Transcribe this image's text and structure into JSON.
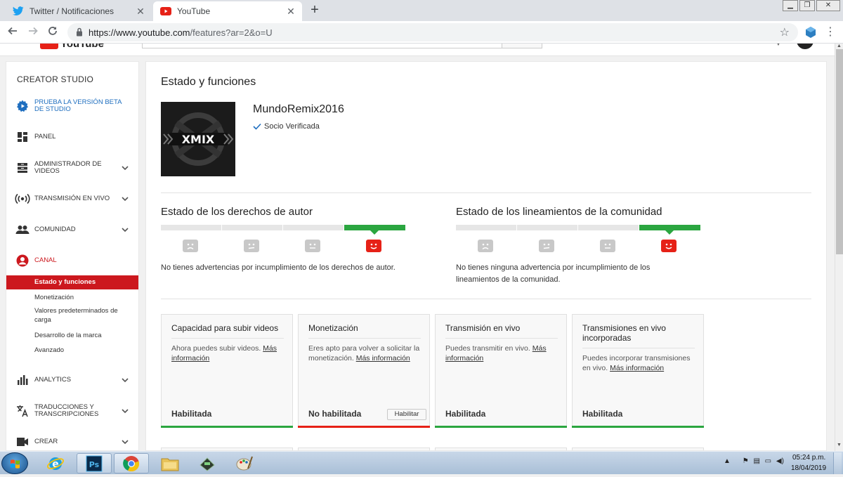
{
  "browser": {
    "tabs": [
      {
        "title": "Twitter / Notificaciones",
        "icon": "twitter-icon"
      },
      {
        "title": "YouTube",
        "icon": "youtube-icon"
      }
    ],
    "url_host": "https://www.youtube.com",
    "url_path": "/features?ar=2&o=U"
  },
  "sidebar": {
    "title": "CREATOR STUDIO",
    "beta_label": "PRUEBA LA VERSIÓN BETA DE STUDIO",
    "items": [
      {
        "label": "PANEL"
      },
      {
        "label": "ADMINISTRADOR DE VIDEOS"
      },
      {
        "label": "TRANSMISIÓN EN VIVO"
      },
      {
        "label": "COMUNIDAD"
      },
      {
        "label": "CANAL"
      },
      {
        "label": "ANALYTICS"
      },
      {
        "label": "TRADUCCIONES Y TRANSCRIPCIONES"
      },
      {
        "label": "CREAR"
      }
    ],
    "canal_sub": [
      "Estado y funciones",
      "Monetización",
      "Valores predeterminados de carga",
      "Desarrollo de la marca",
      "Avanzado"
    ],
    "accent": "#cc181e"
  },
  "main": {
    "title": "Estado y funciones",
    "channel_name": "MundoRemix2016",
    "verified_label": "Socio Verificada",
    "logo_text": "XMIX",
    "copyright": {
      "title": "Estado de los derechos de autor",
      "text": "No tienes advertencias por incumplimiento de los derechos de autor.",
      "level": 4,
      "segments": 4
    },
    "community": {
      "title": "Estado de los lineamientos de la comunidad",
      "text_line1": "No tienes ninguna advertencia por incumplimiento de los",
      "text_line2": "lineamientos de la comunidad.",
      "level": 4,
      "segments": 4
    },
    "cards": [
      {
        "title": "Capacidad para subir videos",
        "desc_a": "Ahora puedes subir videos.",
        "link_a": "Más",
        "link_b": "información",
        "status": "Habilitada",
        "state": "good"
      },
      {
        "title": "Monetización",
        "desc_a": "Eres apto para volver a solicitar la",
        "desc_b": "monetización.",
        "link": "Más información",
        "status": "No habilitada",
        "button": "Habilitar",
        "state": "bad"
      },
      {
        "title": "Transmisión en vivo",
        "desc_a": "Puedes transmitir en vivo.",
        "link_a": "Más",
        "link_b": "información",
        "status": "Habilitada",
        "state": "good"
      },
      {
        "title": "Transmisiones en vivo incorporadas",
        "desc_a": "Puedes incorporar transmisiones",
        "desc_b": "en vivo.",
        "link": "Más información",
        "status": "Habilitada",
        "state": "good"
      }
    ],
    "good_color": "#2ba640",
    "bad_color": "#e62117"
  },
  "taskbar": {
    "time": "05:24 p.m.",
    "date": "18/04/2019"
  }
}
